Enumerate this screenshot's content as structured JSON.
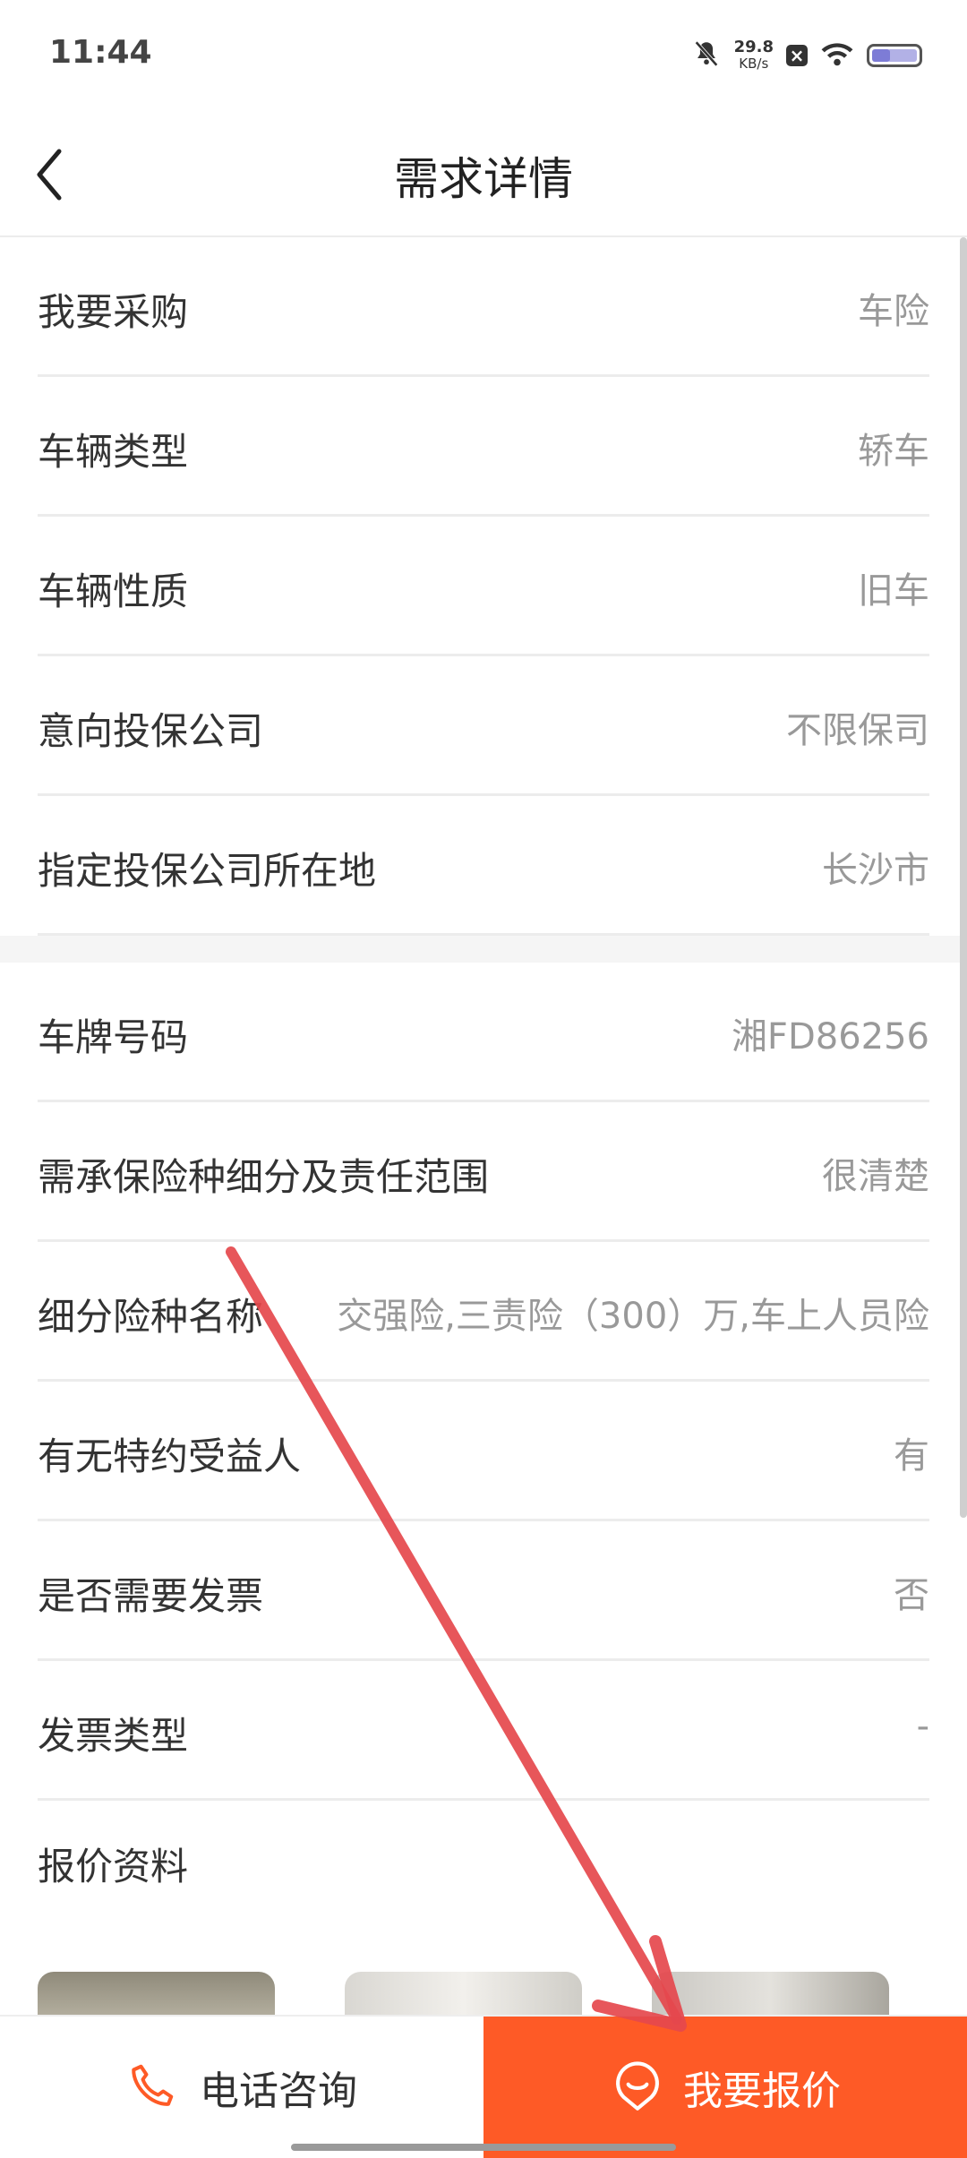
{
  "status_bar": {
    "time": "11:44",
    "net_speed": "29.8",
    "net_unit": "KB/s",
    "icons": [
      "mute-bell-icon",
      "x-notification-icon",
      "wifi-icon",
      "battery-icon"
    ]
  },
  "nav": {
    "title": "需求详情",
    "back_icon": "chevron-left-icon"
  },
  "section1": [
    {
      "label": "我要采购",
      "value": "车险"
    },
    {
      "label": "车辆类型",
      "value": "轿车"
    },
    {
      "label": "车辆性质",
      "value": "旧车"
    },
    {
      "label": "意向投保公司",
      "value": "不限保司"
    },
    {
      "label": "指定投保公司所在地",
      "value": "长沙市"
    }
  ],
  "section2": [
    {
      "label": "车牌号码",
      "value": "湘FD86256"
    },
    {
      "label": "需承保险种细分及责任范围",
      "value": "很清楚"
    },
    {
      "label": "细分险种名称",
      "value": "交强险,三责险（300）万,车上人员险"
    },
    {
      "label": "有无特约受益人",
      "value": "有"
    },
    {
      "label": "是否需要发票",
      "value": "否"
    },
    {
      "label": "发票类型",
      "value": "-"
    }
  ],
  "quote_materials_label": "报价资料",
  "bottom": {
    "call_label": "电话咨询",
    "call_icon": "phone-icon",
    "quote_label": "我要报价",
    "quote_icon": "chat-bubble-icon"
  },
  "colors": {
    "accent": "#fe5a26",
    "annotation_arrow": "#e5484d"
  }
}
